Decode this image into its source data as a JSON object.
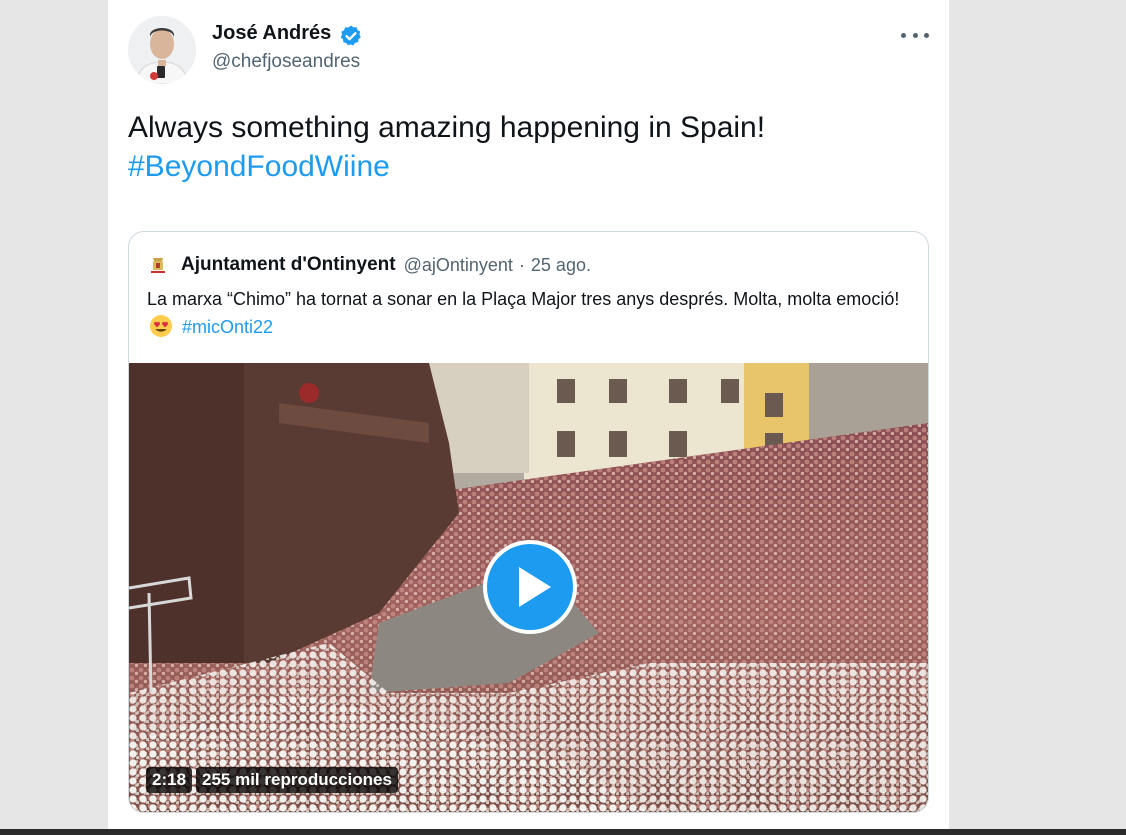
{
  "tweet": {
    "author_name": "José Andrés",
    "author_handle": "@chefjoseandres",
    "text": "Always something amazing happening in Spain!",
    "hashtag": "#BeyondFoodWiine",
    "verified_icon": "verified-badge-icon",
    "more_icon": "more-options-icon"
  },
  "quoted": {
    "author_name": "Ajuntament d'Ontinyent",
    "author_handle": "@ajOntinyent",
    "separator": "·",
    "date": "25 ago.",
    "text": "La marxa “Chimo” ha tornat a sonar en la Plaça Major tres anys després. Molta, molta emoció!",
    "emoji": "heart-eyes-emoji",
    "hashtag": "#micOnti22"
  },
  "video": {
    "duration": "2:18",
    "views": "255 mil reproducciones",
    "play_icon": "play-icon"
  },
  "colors": {
    "accent": "#1d9bf0",
    "text_primary": "#0f1419",
    "text_secondary": "#536471",
    "border": "#cfd9de"
  }
}
